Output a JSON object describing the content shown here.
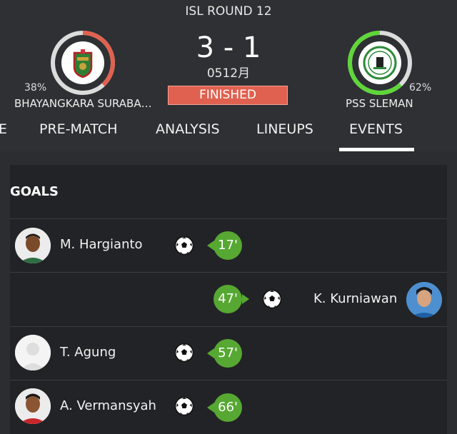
{
  "match": {
    "round": "ISL ROUND 12",
    "score": "3 - 1",
    "date": "0512月",
    "status": "FINISHED"
  },
  "home": {
    "name": "BHAYANGKARA SURABA…",
    "possession": "38%",
    "possession_value": 0.38,
    "ring_color": "#e0614f"
  },
  "away": {
    "name": "PSS SLEMAN",
    "possession": "62%",
    "possession_value": 0.62,
    "ring_color": "#5fd63a"
  },
  "tabs": [
    {
      "label": "E"
    },
    {
      "label": "PRE-MATCH"
    },
    {
      "label": "ANALYSIS"
    },
    {
      "label": "LINEUPS"
    },
    {
      "label": "EVENTS",
      "active": true
    }
  ],
  "goals": {
    "title": "GOALS",
    "events": [
      {
        "player": "M. Hargianto",
        "minute": "17'",
        "side": "home"
      },
      {
        "player": "K. Kurniawan",
        "minute": "47'",
        "side": "away"
      },
      {
        "player": "T. Agung",
        "minute": "57'",
        "side": "home"
      },
      {
        "player": "A. Vermansyah",
        "minute": "66'",
        "side": "home"
      }
    ]
  },
  "colors": {
    "minute_badge": "#56a832",
    "status_bg": "#e0614f"
  },
  "icons": [
    "soccer-ball-icon",
    "team-crest-icon",
    "player-avatar-icon"
  ]
}
